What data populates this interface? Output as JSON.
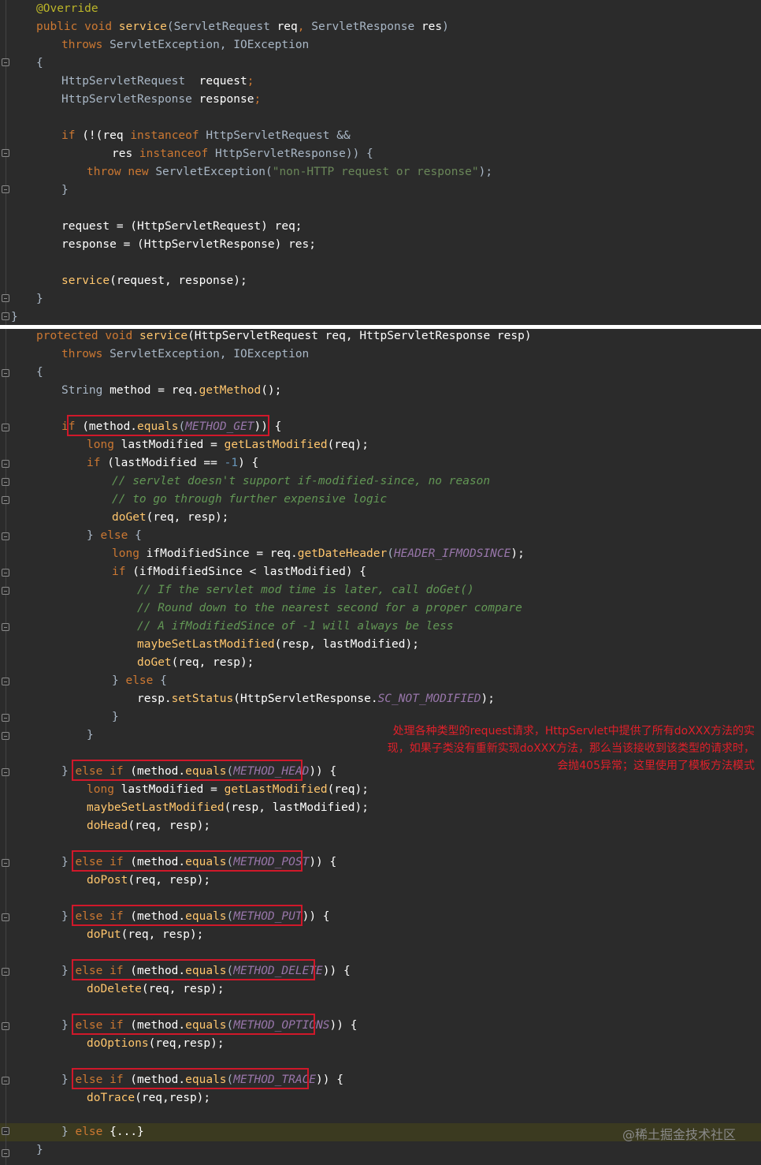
{
  "top": {
    "annotation": "@Override",
    "sig_public": "public",
    "sig_void": "void",
    "sig_name": "service",
    "sig_param1_type": "ServletRequest",
    "sig_param1": "req",
    "sig_param2_type": "ServletResponse",
    "sig_param2": "res",
    "throws_kw": "throws",
    "throws_list": "ServletException, IOException",
    "decl1_type": "HttpServletRequest",
    "decl1_name": "request",
    "decl2_type": "HttpServletResponse",
    "decl2_name": "response",
    "if_kw": "if",
    "if_cond1": "(!(req ",
    "instanceof": "instanceof",
    "if_cond1_type": "HttpServletRequest &&",
    "if_cond2_a": "res ",
    "if_cond2_type": "HttpServletResponse)) {",
    "throw_kw": "throw new",
    "throw_type": "ServletException(",
    "throw_msg": "\"non-HTTP request or response\"",
    "throw_end": ");",
    "assign1": "request = (HttpServletRequest) req;",
    "assign2": "response = (HttpServletResponse) res;",
    "call_name": "service",
    "call_args": "(request, response);"
  },
  "bottom": {
    "sig_protected": "protected",
    "sig_void": "void",
    "sig_name": "service",
    "sig_params": "(HttpServletRequest req, HttpServletResponse resp)",
    "throws_kw": "throws",
    "throws_list": "ServletException, IOException",
    "method_decl_type": "String",
    "method_decl": " method = req.",
    "get_method": "getMethod",
    "get_method_end": "();",
    "if_get_kw": "if",
    "if_get_a": " (method.",
    "equals": "equals",
    "method_get": "METHOD_GET",
    "if_get_end": ")) {",
    "long_kw": "long",
    "lm_decl": " lastModified = ",
    "get_last_modified": "getLastModified",
    "lm_decl_end": "(req);",
    "if_lm_kw": "if",
    "if_lm_a": " (lastModified == ",
    "neg_one": "-1",
    "if_lm_end": ") {",
    "comment1": "// servlet doesn't support if-modified-since, no reason",
    "comment2": "// to go through further expensive logic",
    "do_get": "doGet",
    "do_get_args": "(req, resp);",
    "else_kw": "else",
    "ims_decl": " ifModifiedSince = req.",
    "get_date_header": "getDateHeader",
    "header_const": "HEADER_IFMODSINCE",
    "ims_end": ");",
    "if_ims_a": " (ifModifiedSince < lastModified) {",
    "comment3": "// If the servlet mod time is later, call doGet()",
    "comment4": "// Round down to the nearest second for a proper compare",
    "comment5": "// A ifModifiedSince of -1 will always be less",
    "maybe_set": "maybeSetLastModified",
    "maybe_set_args": "(resp, lastModified);",
    "set_status_a": "resp.",
    "set_status": "setStatus",
    "set_status_b": "(HttpServletResponse.",
    "sc_not_modified": "SC_NOT_MODIFIED",
    "else_if": "else if",
    "method_head": "METHOD_HEAD",
    "do_head": "doHead",
    "method_post": "METHOD_POST",
    "do_post": "doPost",
    "method_put": "METHOD_PUT",
    "do_put": "doPut",
    "method_delete": "METHOD_DELETE",
    "do_delete": "doDelete",
    "method_options": "METHOD_OPTIONS",
    "do_options": "doOptions",
    "do_options_args": "(req,resp);",
    "method_trace": "METHOD_TRACE",
    "do_trace": "doTrace",
    "folded": "{...}",
    "annotation_note": "处理各种类型的request请求，HttpServlet中提供了所有doXXX方法的实现，如果子类没有重新实现doXXX方法，那么当该接收到该类型的请求时，会抛405异常；这里使用了模板方法模式",
    "watermark": "@稀土掘金技术社区"
  },
  "colors": {
    "background": "#2b2b2b",
    "keyword": "#cc7832",
    "method": "#ffc66d",
    "string": "#6a8759",
    "number": "#6897bb",
    "comment": "#629755",
    "constant": "#9876aa",
    "highlight_box": "#d0182a",
    "note_text": "#e0202a"
  }
}
